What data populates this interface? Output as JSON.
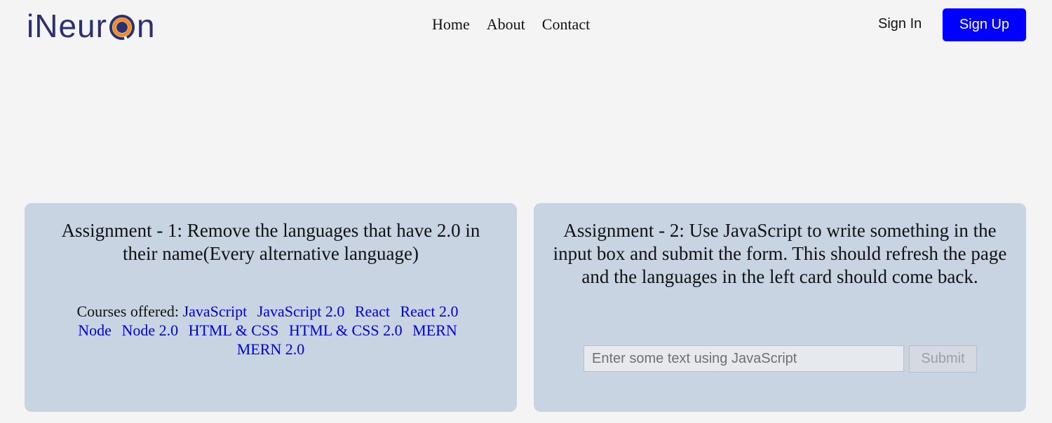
{
  "header": {
    "logo": {
      "prefix": "iNeur",
      "suffix": "n",
      "colors": {
        "text": "#2b3170",
        "ring_outer": "#2b3170",
        "ring_inner": "#f28c1e"
      }
    },
    "nav": [
      {
        "label": "Home"
      },
      {
        "label": "About"
      },
      {
        "label": "Contact"
      }
    ],
    "sign_in_label": "Sign In",
    "sign_up_label": "Sign Up",
    "accent_color": "#0000ff"
  },
  "assignment1": {
    "title": "Assignment - 1: Remove the languages that have 2.0 in their name(Every alternative language)",
    "courses_label": "Courses offered:",
    "courses": [
      "JavaScript",
      "JavaScript 2.0",
      "React",
      "React 2.0",
      "Node",
      "Node 2.0",
      "HTML & CSS",
      "HTML & CSS 2.0",
      "MERN",
      "MERN 2.0"
    ],
    "link_color": "#0000dd"
  },
  "assignment2": {
    "title": "Assignment - 2: Use JavaScript to write something in the input box and submit the form. This should refresh the page and the languages in the left card should come back.",
    "input": {
      "value": "",
      "placeholder": "Enter some text using JavaScript"
    },
    "submit_label": "Submit"
  },
  "colors": {
    "background": "#f4f4f4",
    "card_background": "#c8d4e1"
  }
}
